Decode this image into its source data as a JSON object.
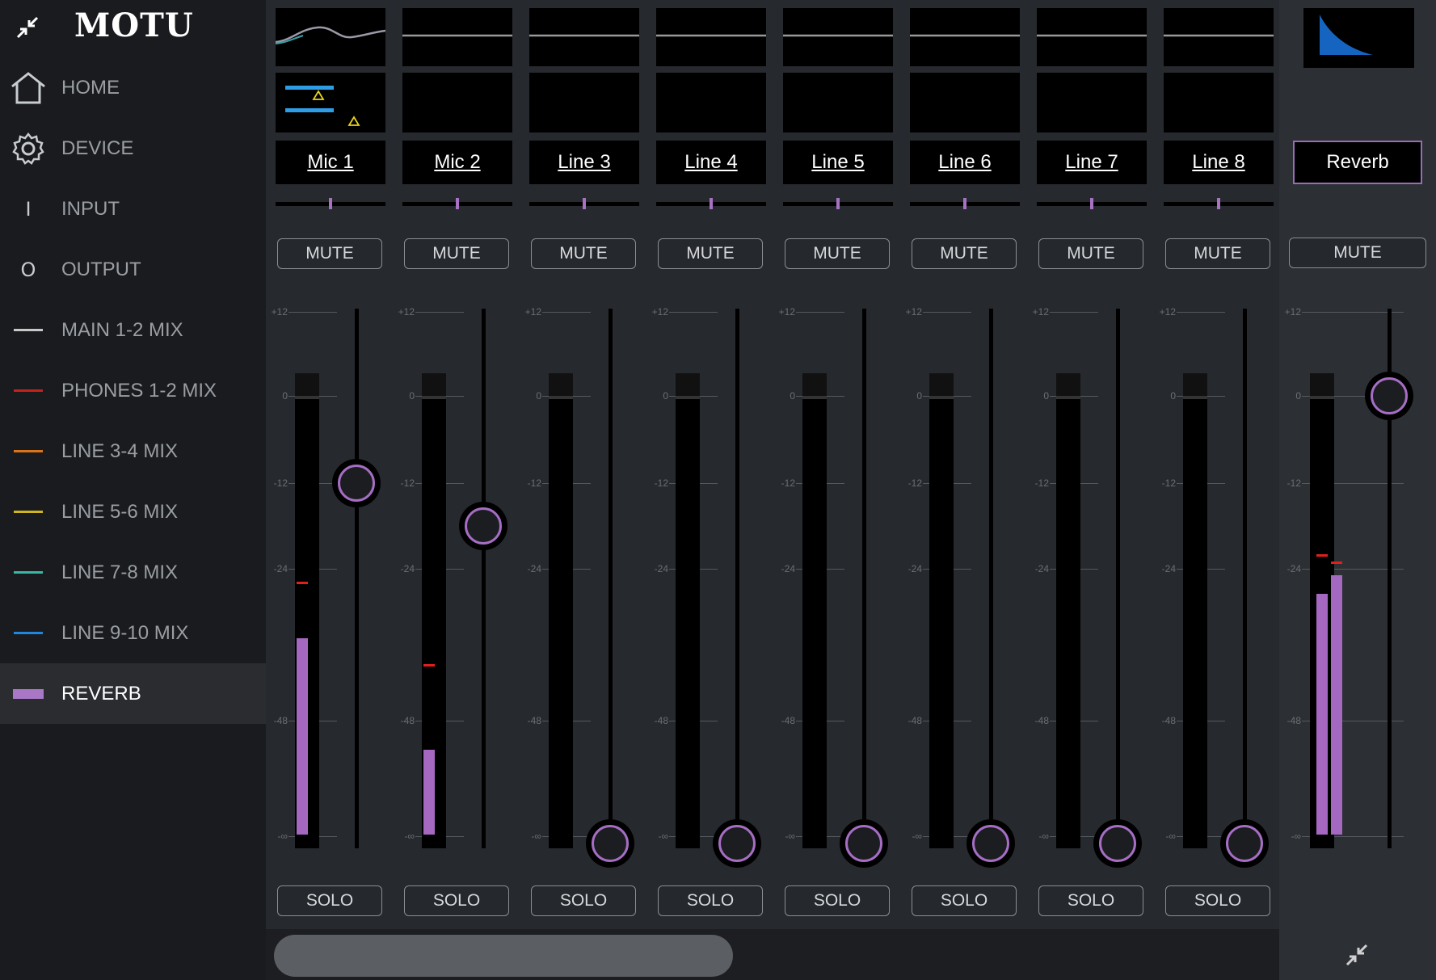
{
  "app": {
    "logo": "MOTU"
  },
  "sidebar": {
    "items": [
      {
        "label": "HOME",
        "icon": "home-icon"
      },
      {
        "label": "DEVICE",
        "icon": "gear-icon"
      },
      {
        "label": "INPUT",
        "icon": "input-icon",
        "glyph": "I"
      },
      {
        "label": "OUTPUT",
        "icon": "output-icon",
        "glyph": "O"
      },
      {
        "label": "MAIN 1-2 MIX",
        "icon": "mix-line-icon",
        "color": "#c8c8c8"
      },
      {
        "label": "PHONES 1-2 MIX",
        "icon": "mix-line-icon",
        "color": "#c4221b"
      },
      {
        "label": "LINE 3-4 MIX",
        "icon": "mix-line-icon",
        "color": "#d9741c"
      },
      {
        "label": "LINE 5-6 MIX",
        "icon": "mix-line-icon",
        "color": "#d1b41e"
      },
      {
        "label": "LINE 7-8 MIX",
        "icon": "mix-line-icon",
        "color": "#38b8a2"
      },
      {
        "label": "LINE 9-10 MIX",
        "icon": "mix-line-icon",
        "color": "#1e88e0"
      },
      {
        "label": "REVERB",
        "icon": "mix-line-icon",
        "color": "#a877c6",
        "active": true
      }
    ]
  },
  "scale_labels": [
    "+12",
    "0",
    "-12",
    "-24",
    "-48",
    "-∞"
  ],
  "channels": [
    {
      "name": "Mic 1",
      "mute": "MUTE",
      "solo": "SOLO",
      "fader_db": -12,
      "meter_db": -35,
      "peak_db": -26
    },
    {
      "name": "Mic 2",
      "mute": "MUTE",
      "solo": "SOLO",
      "fader_db": -18,
      "meter_db": -51,
      "peak_db": -39
    },
    {
      "name": "Line 3",
      "mute": "MUTE",
      "solo": "SOLO",
      "fader_db": null
    },
    {
      "name": "Line 4",
      "mute": "MUTE",
      "solo": "SOLO",
      "fader_db": null
    },
    {
      "name": "Line 5",
      "mute": "MUTE",
      "solo": "SOLO",
      "fader_db": null
    },
    {
      "name": "Line 6",
      "mute": "MUTE",
      "solo": "SOLO",
      "fader_db": null
    },
    {
      "name": "Line 7",
      "mute": "MUTE",
      "solo": "SOLO",
      "fader_db": null
    },
    {
      "name": "Line 8",
      "mute": "MUTE",
      "solo": "SOLO",
      "fader_db": null
    }
  ],
  "reverb": {
    "name": "Reverb",
    "mute": "MUTE",
    "fader_db": 0,
    "meter_l_db": -28,
    "meter_r_db": -25,
    "peak_l_db": -22,
    "peak_r_db": -23
  },
  "colors": {
    "accent": "#a56ec4",
    "peak": "#e0201a",
    "reverb_graph": "#1565c0"
  }
}
